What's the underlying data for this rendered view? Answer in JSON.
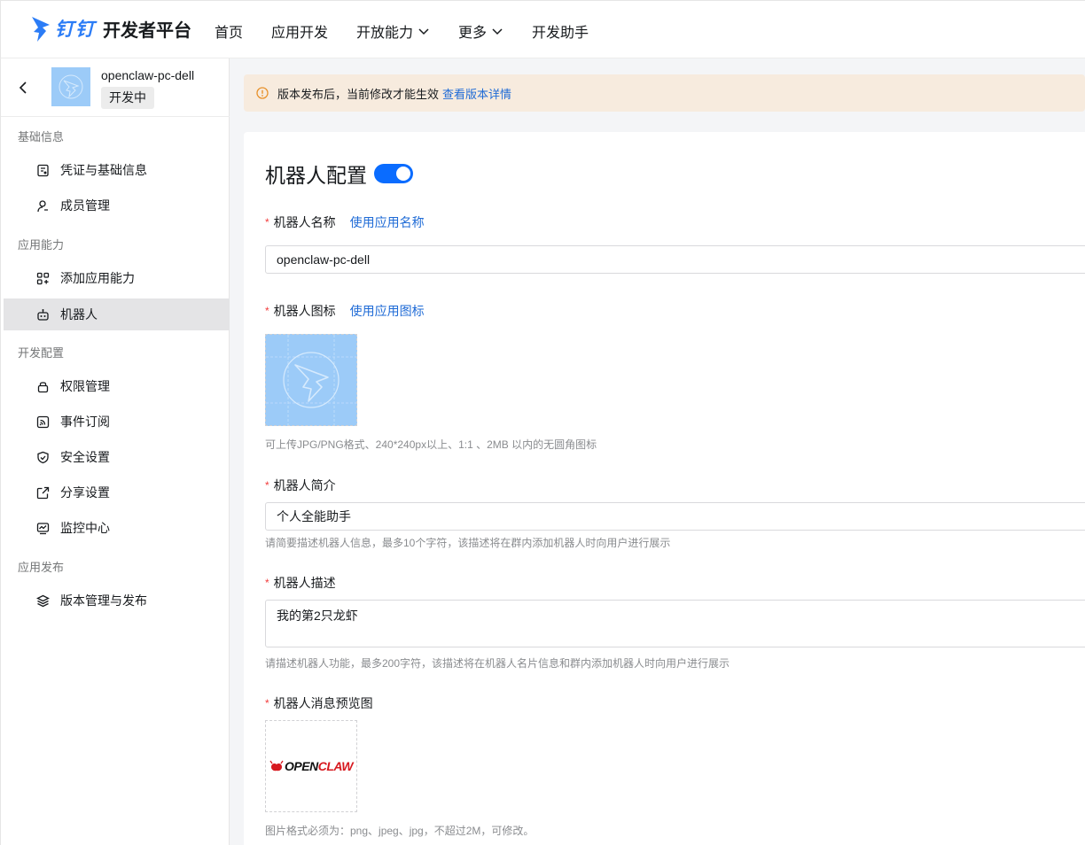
{
  "brand": {
    "name": "钉钉",
    "subtitle": "开发者平台"
  },
  "nav": [
    {
      "label": "首页"
    },
    {
      "label": "应用开发"
    },
    {
      "label": "开放能力"
    },
    {
      "label": "更多"
    },
    {
      "label": "开发助手"
    }
  ],
  "app": {
    "name": "openclaw-pc-dell",
    "status": "开发中"
  },
  "sidebar": {
    "groups": [
      {
        "title": "基础信息",
        "items": [
          {
            "label": "凭证与基础信息",
            "icon": "credential-icon"
          },
          {
            "label": "成员管理",
            "icon": "user-icon"
          }
        ]
      },
      {
        "title": "应用能力",
        "items": [
          {
            "label": "添加应用能力",
            "icon": "grid-add-icon"
          },
          {
            "label": "机器人",
            "icon": "robot-icon",
            "active": true
          }
        ]
      },
      {
        "title": "开发配置",
        "items": [
          {
            "label": "权限管理",
            "icon": "lock-icon"
          },
          {
            "label": "事件订阅",
            "icon": "rss-icon"
          },
          {
            "label": "安全设置",
            "icon": "shield-icon"
          },
          {
            "label": "分享设置",
            "icon": "share-icon"
          },
          {
            "label": "监控中心",
            "icon": "monitor-icon"
          }
        ]
      },
      {
        "title": "应用发布",
        "items": [
          {
            "label": "版本管理与发布",
            "icon": "layers-icon"
          }
        ]
      }
    ]
  },
  "notice": {
    "text": "版本发布后，当前修改才能生效",
    "link": "查看版本详情"
  },
  "form": {
    "title": "机器人配置",
    "enabled": true,
    "name": {
      "label": "机器人名称",
      "link": "使用应用名称",
      "value": "openclaw-pc-dell"
    },
    "icon": {
      "label": "机器人图标",
      "link": "使用应用图标",
      "hint": "可上传JPG/PNG格式、240*240px以上、1:1 、2MB 以内的无圆角图标"
    },
    "intro": {
      "label": "机器人简介",
      "value": "个人全能助手",
      "hint": "请简要描述机器人信息，最多10个字符，该描述将在群内添加机器人时向用户进行展示"
    },
    "desc": {
      "label": "机器人描述",
      "value": "我的第2只龙虾",
      "hint": "请描述机器人功能，最多200字符，该描述将在机器人名片信息和群内添加机器人时向用户进行展示"
    },
    "preview": {
      "label": "机器人消息预览图",
      "logo_dark": "OPEN",
      "logo_red": "CLAW",
      "hint": "图片格式必须为：png、jpeg、jpg，不超过2M，可修改。"
    }
  },
  "colors": {
    "accent": "#0a6cff",
    "link": "#1f6bd6",
    "required": "#f23b3b",
    "notice_bg": "#f7ebde",
    "icon_bg": "#9ccbf8"
  }
}
